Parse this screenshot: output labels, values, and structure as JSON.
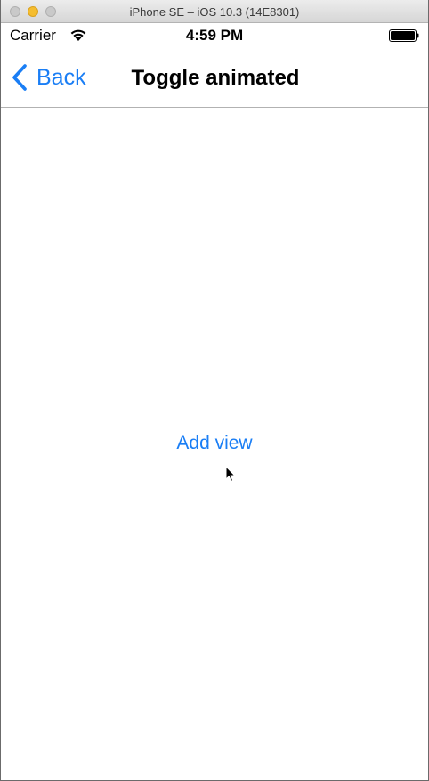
{
  "window": {
    "title": "iPhone SE – iOS 10.3 (14E8301)"
  },
  "status_bar": {
    "carrier": "Carrier",
    "time": "4:59 PM",
    "wifi_icon": "wifi-icon",
    "battery_icon": "battery-icon"
  },
  "nav_bar": {
    "back_label": "Back",
    "back_icon": "chevron-left-icon",
    "title": "Toggle animated"
  },
  "content": {
    "add_view_label": "Add view"
  },
  "colors": {
    "tint": "#1a7ef5",
    "background": "#ffffff"
  }
}
